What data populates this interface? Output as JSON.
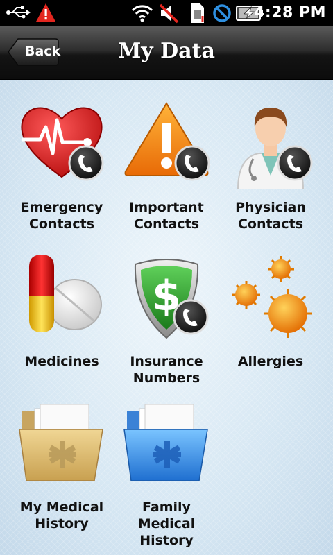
{
  "status_bar": {
    "time": "4:28 PM",
    "icons": [
      "usb-icon",
      "warning-icon",
      "wifi-icon",
      "muted-icon",
      "sim-icon",
      "no-signal-icon",
      "battery-charging-icon"
    ]
  },
  "header": {
    "title": "My Data",
    "back_label": "Back"
  },
  "tiles": [
    {
      "label": "Emergency\nContacts",
      "icon": "heartbeat-phone-icon"
    },
    {
      "label": "Important\nContacts",
      "icon": "warning-phone-icon"
    },
    {
      "label": "Physician\nContacts",
      "icon": "doctor-phone-icon"
    },
    {
      "label": "Medicines",
      "icon": "pills-icon"
    },
    {
      "label": "Insurance\nNumbers",
      "icon": "dollar-shield-phone-icon"
    },
    {
      "label": "Allergies",
      "icon": "pollen-icon"
    },
    {
      "label": "My Medical\nHistory",
      "icon": "medical-folder-icon"
    },
    {
      "label": "Family\nMedical\nHistory",
      "icon": "family-medical-folder-icon"
    }
  ],
  "colors": {
    "background": "#d6e7f3",
    "title_bar": "#1a1a1a",
    "label_text": "#111111"
  }
}
